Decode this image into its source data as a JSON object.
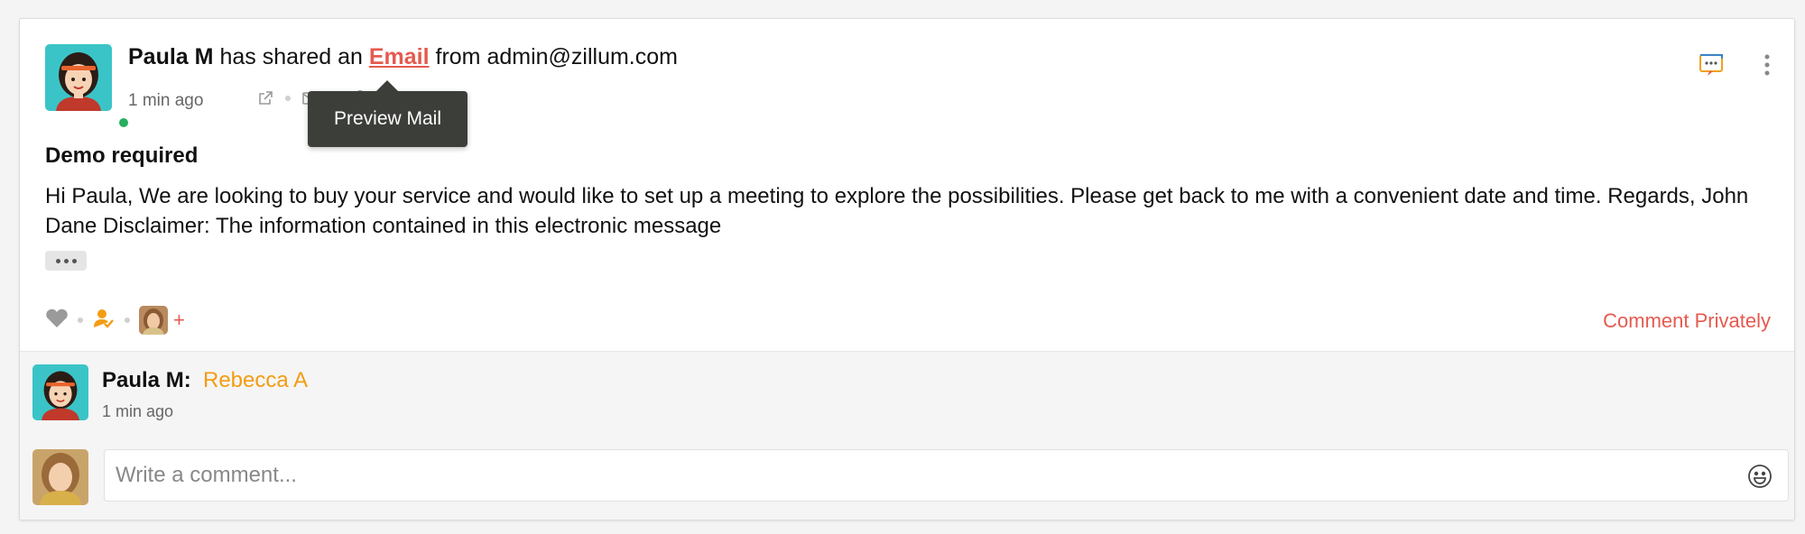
{
  "post": {
    "author": "Paula M",
    "action_text": "has shared an",
    "link_text": "Email",
    "from_text": "from admin@zillum.com",
    "time": "1 min ago",
    "subject": "Demo required",
    "body": "Hi Paula, We are looking to buy your service and would like to set up a meeting to explore the possibilities. Please get back to me with a convenient date and time. Regards, John Dane Disclaimer: The information contained in this electronic message",
    "tooltip": "Preview Mail"
  },
  "actions": {
    "plus_label": "+",
    "comment_privately": "Comment Privately"
  },
  "reply": {
    "author": "Paula M:",
    "mention": "Rebecca A",
    "time": "1 min ago"
  },
  "comment_box": {
    "placeholder": "Write a comment..."
  },
  "colors": {
    "accent": "#e55a4f",
    "mention": "#f39c12",
    "online": "#27ae60",
    "tooltip_bg": "#3c3e3a"
  },
  "icons": [
    "external-link-icon",
    "email-icon",
    "attachment-icon",
    "chat-icon",
    "more-vertical-icon",
    "heart-icon",
    "user-check-icon",
    "plus-icon",
    "smiley-icon"
  ]
}
